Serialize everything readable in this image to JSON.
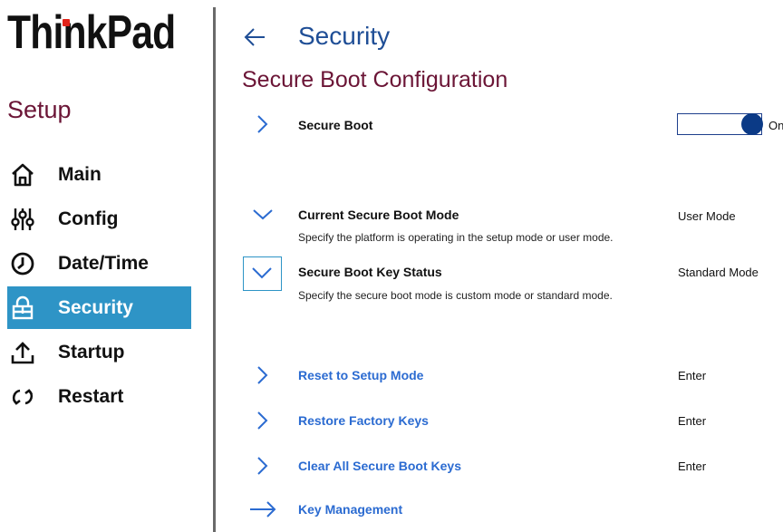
{
  "sidebar": {
    "logo": "ThinkPad",
    "setup_title": "Setup",
    "items": [
      {
        "label": "Main",
        "icon": "home-icon"
      },
      {
        "label": "Config",
        "icon": "sliders-icon"
      },
      {
        "label": "Date/Time",
        "icon": "clock-icon"
      },
      {
        "label": "Security",
        "icon": "lock-icon",
        "active": true
      },
      {
        "label": "Startup",
        "icon": "upload-icon"
      },
      {
        "label": "Restart",
        "icon": "restart-icon"
      }
    ]
  },
  "header": {
    "title": "Security",
    "subtitle": "Secure Boot Configuration"
  },
  "settings": {
    "secure_boot": {
      "label": "Secure Boot",
      "toggle_state": "On"
    },
    "current_mode": {
      "label": "Current Secure Boot Mode",
      "value": "User Mode",
      "description": "Specify the platform is operating in the setup mode or user mode."
    },
    "key_status": {
      "label": "Secure Boot Key Status",
      "value": "Standard Mode",
      "description": "Specify the secure boot mode is custom mode or standard mode."
    },
    "reset_setup": {
      "label": "Reset to Setup Mode",
      "value": "Enter"
    },
    "restore_keys": {
      "label": "Restore Factory Keys",
      "value": "Enter"
    },
    "clear_keys": {
      "label": "Clear All Secure Boot Keys",
      "value": "Enter"
    },
    "key_management": {
      "label": "Key Management"
    }
  },
  "colors": {
    "accent": "#2e94c6",
    "title_blue": "#1f4e96",
    "subtitle_maroon": "#6b1536",
    "link_blue": "#2b6bd1",
    "logo_dot_red": "#e2231a"
  }
}
